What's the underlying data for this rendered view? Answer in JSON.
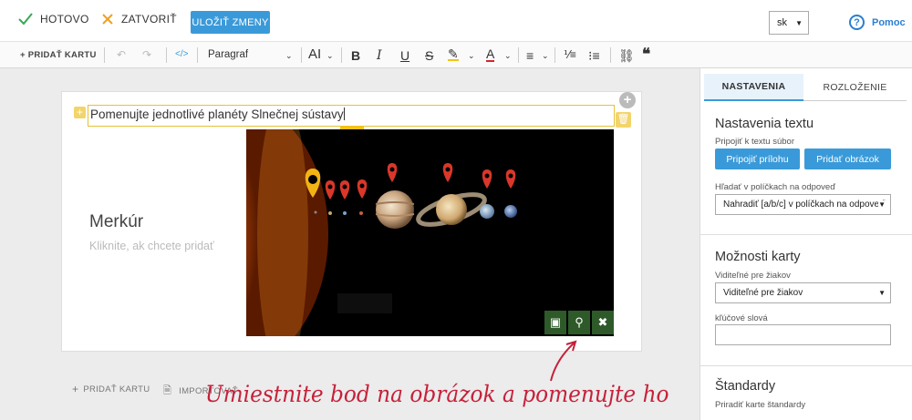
{
  "topbar": {
    "done_label": "HOTOVO",
    "close_label": "ZATVORIŤ",
    "save_label": "ULOŽIŤ ZMENY",
    "language": "sk",
    "help_label": "Pomoc"
  },
  "toolbar": {
    "add_card_label": "+ PRIDAŤ KARTU",
    "paragraph_select": "Paragraf"
  },
  "card": {
    "question": "Pomenujte jednotlivé planéty Slnečnej sústavy",
    "term": "Merkúr",
    "term_placeholder": "Kliknite, ak chcete pridať"
  },
  "bottom": {
    "add_card_label": "PRIDAŤ KARTU",
    "import_label": "IMPORTOVAŤ"
  },
  "annotation": "Umiestnite bod na obrázok a pomenujte ho",
  "panel": {
    "tabs": [
      "NASTAVENIA",
      "ROZLOŽENIE"
    ],
    "text_settings": {
      "heading": "Nastavenia textu",
      "attach_label": "Pripojiť k textu súbor",
      "attach_button": "Pripojiť prílohu",
      "add_image_button": "Pridať obrázok",
      "search_label": "Hľadať v políčkach na odpoveď",
      "search_value": "Nahradiť [a/b/c] v políčkach na odpoveď"
    },
    "card_options": {
      "heading": "Možnosti karty",
      "visible_label": "Viditeľné pre žiakov",
      "visible_value": "Viditeľné pre žiakov",
      "keywords_label": "kľúčové slová",
      "keywords_value": ""
    },
    "standards": {
      "heading": "Štandardy",
      "assign_label": "Priradiť karte štandardy"
    }
  },
  "colors": {
    "accent": "#3a9ad9",
    "highlight": "#e4c23a",
    "annotation": "#c6213a",
    "image_action": "#2e5a2a"
  }
}
